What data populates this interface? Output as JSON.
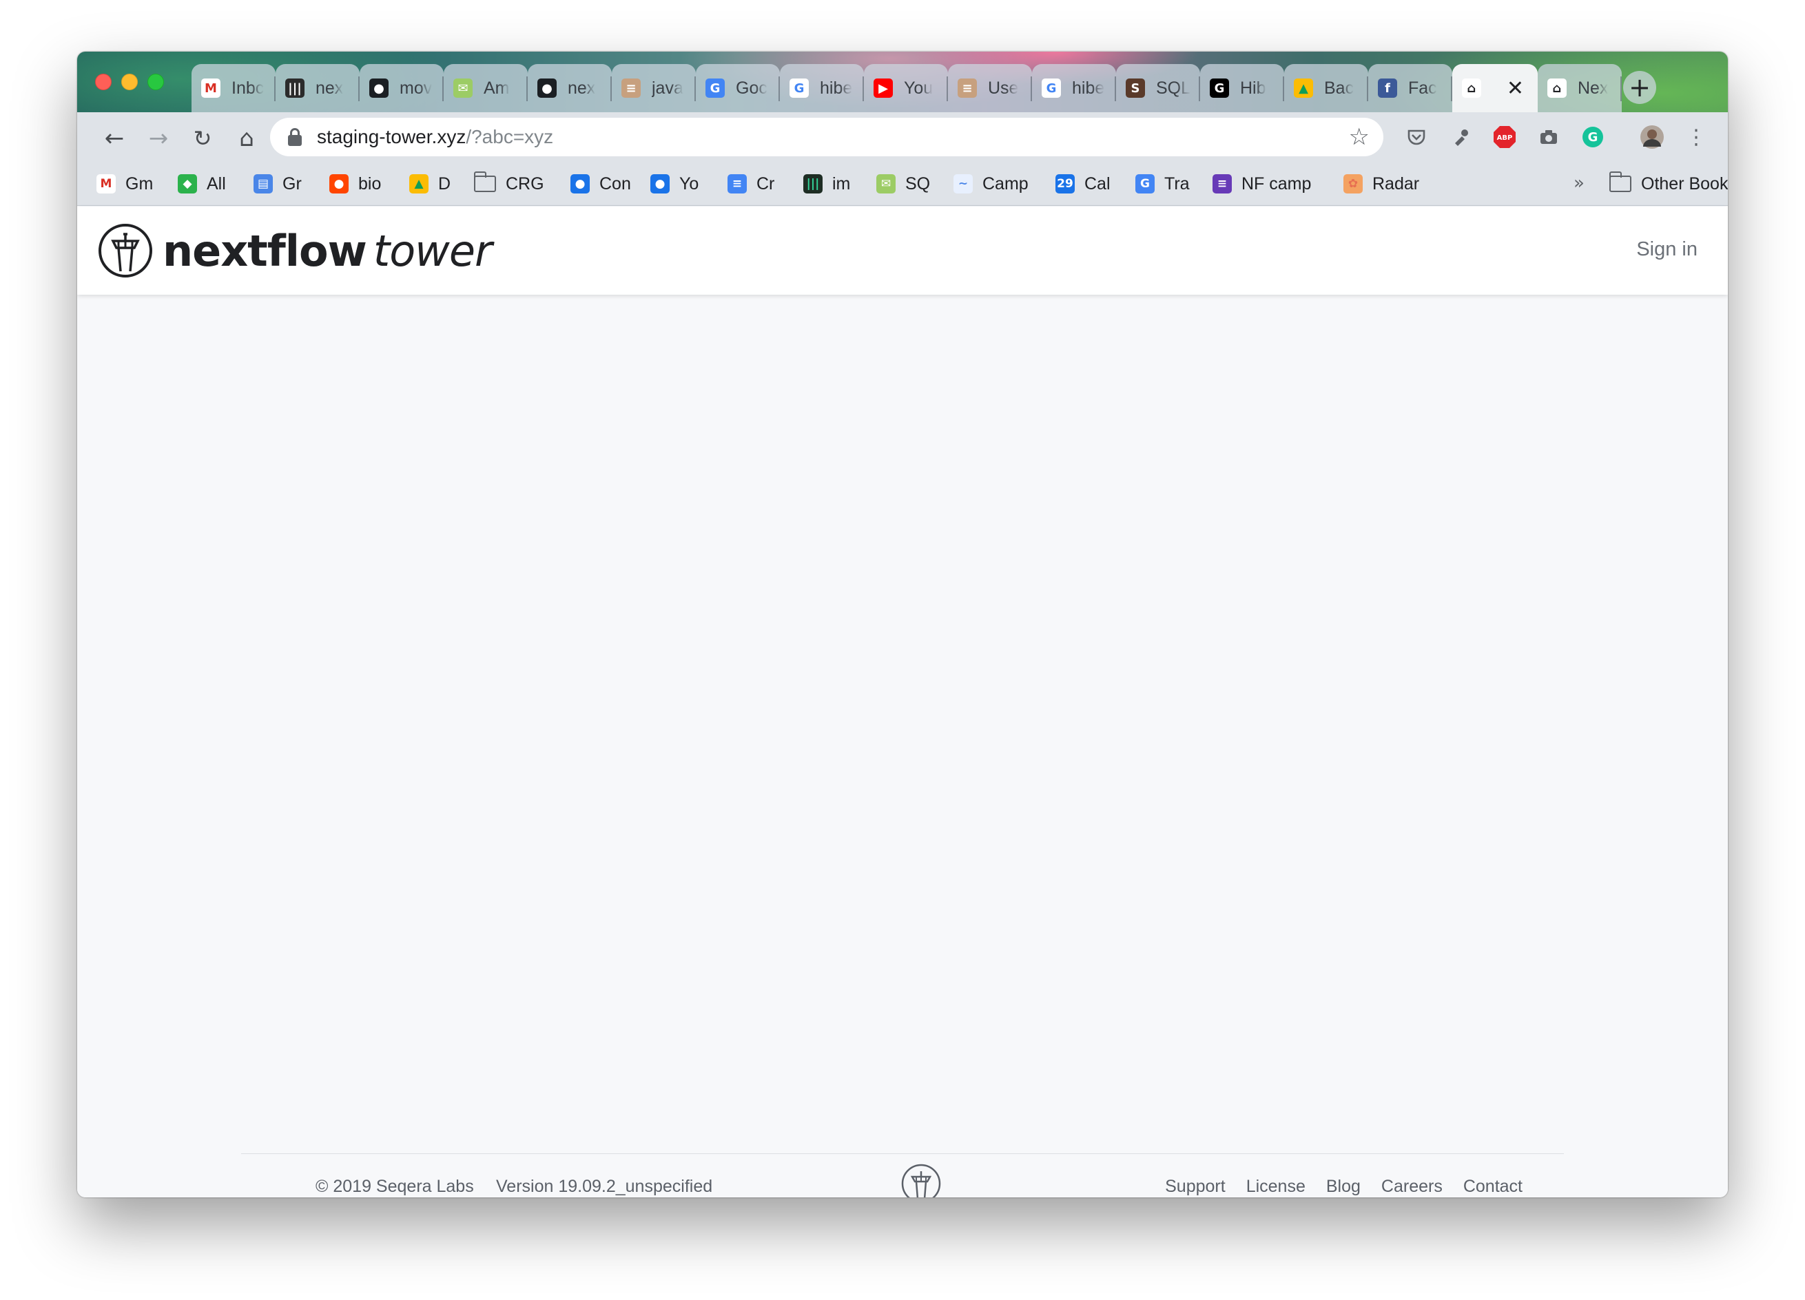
{
  "browser": {
    "tabs": [
      {
        "label": "Inbc",
        "icon": "gmail-icon",
        "color": "#ffffff",
        "glyph": "M",
        "glyph_color": "#d93025"
      },
      {
        "label": "nex",
        "icon": "bars-icon",
        "color": "#2b2b2b",
        "glyph": "|||",
        "glyph_color": "#ffffff"
      },
      {
        "label": "mov",
        "icon": "github-icon",
        "color": "#1b1f23",
        "glyph": "●",
        "glyph_color": "#ffffff"
      },
      {
        "label": "Am",
        "icon": "mail-icon",
        "color": "#9ccc65",
        "glyph": "✉",
        "glyph_color": "#ffffff"
      },
      {
        "label": "nex",
        "icon": "github-icon",
        "color": "#1b1f23",
        "glyph": "●",
        "glyph_color": "#ffffff"
      },
      {
        "label": "java",
        "icon": "stackoverflow-icon",
        "color": "#c7a07e",
        "glyph": "≡",
        "glyph_color": "#ffffff"
      },
      {
        "label": "Goc",
        "icon": "translate-icon",
        "color": "#4285f4",
        "glyph": "G",
        "glyph_color": "#ffffff"
      },
      {
        "label": "hibe",
        "icon": "google-icon",
        "color": "#ffffff",
        "glyph": "G",
        "glyph_color": "#4285f4"
      },
      {
        "label": "You",
        "icon": "youtube-icon",
        "color": "#ff0000",
        "glyph": "▶",
        "glyph_color": "#ffffff"
      },
      {
        "label": "Use",
        "icon": "stackoverflow-icon",
        "color": "#c7a07e",
        "glyph": "≡",
        "glyph_color": "#ffffff"
      },
      {
        "label": "hibe",
        "icon": "google-icon",
        "color": "#ffffff",
        "glyph": "G",
        "glyph_color": "#4285f4"
      },
      {
        "label": "SQL",
        "icon": "sql-icon",
        "color": "#5a3a2a",
        "glyph": "S",
        "glyph_color": "#ffffff"
      },
      {
        "label": "Hib",
        "icon": "g-icon",
        "color": "#000000",
        "glyph": "G",
        "glyph_color": "#ffffff"
      },
      {
        "label": "Bac",
        "icon": "drive-icon",
        "color": "#fbbc04",
        "glyph": "▲",
        "glyph_color": "#0f9d58"
      },
      {
        "label": "Fac",
        "icon": "facebook-icon",
        "color": "#3b5998",
        "glyph": "f",
        "glyph_color": "#ffffff"
      },
      {
        "label": "",
        "icon": "tower-icon",
        "color": "#ffffff",
        "glyph": "⌂",
        "glyph_color": "#202124",
        "active": true
      },
      {
        "label": "Nex",
        "icon": "tower-icon",
        "color": "#ffffff",
        "glyph": "⌂",
        "glyph_color": "#202124"
      }
    ],
    "url_host": "staging-tower.xyz",
    "url_rest": "/?abc=xyz",
    "bookmarks": [
      {
        "label": "Gm",
        "icon": "gmail-icon",
        "color": "#ffffff",
        "glyph": "M",
        "glyph_color": "#d93025"
      },
      {
        "label": "All",
        "icon": "feedly-icon",
        "color": "#2bb24c",
        "glyph": "◆",
        "glyph_color": "#ffffff"
      },
      {
        "label": "Gr",
        "icon": "classroom-icon",
        "color": "#4a86e8",
        "glyph": "▤",
        "glyph_color": "#ffffff"
      },
      {
        "label": "bio",
        "icon": "reddit-icon",
        "color": "#ff4500",
        "glyph": "●",
        "glyph_color": "#ffffff"
      },
      {
        "label": "D",
        "icon": "drive-icon",
        "color": "#fbbc04",
        "glyph": "▲",
        "glyph_color": "#0f9d58"
      },
      {
        "label": "CRG",
        "icon": "folder-icon",
        "color": "",
        "glyph": "",
        "glyph_color": ""
      },
      {
        "label": "Con",
        "icon": "contacts-icon",
        "color": "#1a73e8",
        "glyph": "●",
        "glyph_color": "#ffffff"
      },
      {
        "label": "Yo",
        "icon": "contacts-icon",
        "color": "#1a73e8",
        "glyph": "●",
        "glyph_color": "#ffffff"
      },
      {
        "label": "Cr",
        "icon": "docs-icon",
        "color": "#4285f4",
        "glyph": "≡",
        "glyph_color": "#ffffff"
      },
      {
        "label": "im",
        "icon": "bars-icon",
        "color": "#1e2d24",
        "glyph": "|||",
        "glyph_color": "#34d399"
      },
      {
        "label": "SQ",
        "icon": "mail-icon",
        "color": "#9ccc65",
        "glyph": "✉",
        "glyph_color": "#ffffff"
      },
      {
        "label": "Camp",
        "icon": "campaign-icon",
        "color": "#e8f0fe",
        "glyph": "~",
        "glyph_color": "#4a86e8"
      },
      {
        "label": "Cal",
        "icon": "calendar-icon",
        "color": "#1a73e8",
        "glyph": "29",
        "glyph_color": "#ffffff"
      },
      {
        "label": "Tra",
        "icon": "translate-icon",
        "color": "#4285f4",
        "glyph": "G",
        "glyph_color": "#ffffff"
      },
      {
        "label": "NF camp",
        "icon": "forms-icon",
        "color": "#673ab7",
        "glyph": "≡",
        "glyph_color": "#ffffff"
      },
      {
        "label": "Radar",
        "icon": "radar-icon",
        "color": "#f4a261",
        "glyph": "✿",
        "glyph_color": "#e76f51"
      }
    ],
    "bookmarks_overflow": "»",
    "other_bookmarks": "Other Bookmarks"
  },
  "app": {
    "brand": "nextflow",
    "product": "tower",
    "signin": "Sign in"
  },
  "footer": {
    "copyright": "© 2019 Seqera Labs",
    "version": "Version 19.09.2_unspecified",
    "links": [
      "Support",
      "License",
      "Blog",
      "Careers",
      "Contact"
    ]
  }
}
